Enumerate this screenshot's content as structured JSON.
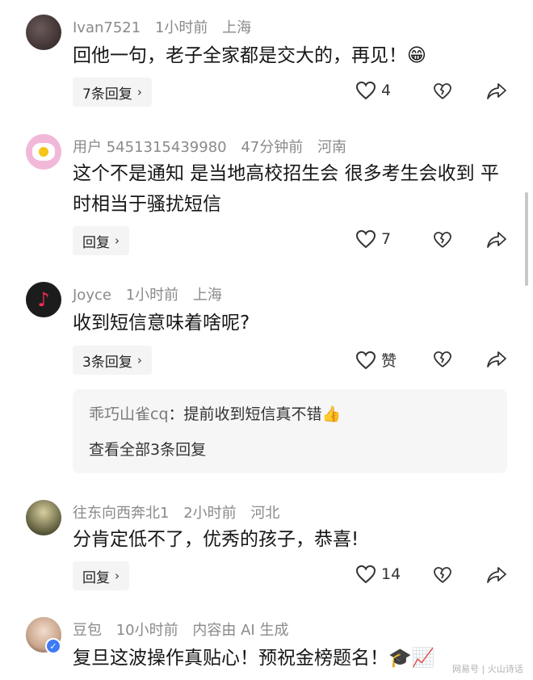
{
  "comments": [
    {
      "user": "Ivan7521",
      "time": "1小时前",
      "location": "上海",
      "text": "回他一句，老子全家都是交大的，再见！😁",
      "reply_label": "7条回复",
      "likes": "4"
    },
    {
      "user": "用户 5451315439980",
      "time": "47分钟前",
      "location": "河南",
      "text": "这个不是通知 是当地高校招生会 很多考生会收到 平时相当于骚扰短信",
      "reply_label": "回复",
      "likes": "7"
    },
    {
      "user": "Joyce",
      "time": "1小时前",
      "location": "上海",
      "text": "收到短信意味着啥呢?",
      "reply_label": "3条回复",
      "likes": "赞",
      "sub_reply": {
        "user": "乖巧山雀cq",
        "text": "提前收到短信真不错👍",
        "view_all": "查看全部3条回复"
      }
    },
    {
      "user": "往东向西奔北1",
      "time": "2小时前",
      "location": "河北",
      "text": "分肯定低不了，优秀的孩子，恭喜!",
      "reply_label": "回复",
      "likes": "14"
    },
    {
      "user": "豆包",
      "time": "10小时前",
      "location": "内容由 AI 生成",
      "text": "复旦这波操作真贴心！预祝金榜题名！🎓📈"
    }
  ],
  "icons": {
    "like": "heart-outline-icon",
    "dislike": "broken-heart-icon",
    "share": "share-arrow-icon",
    "chevron": "chevron-right-icon",
    "verified": "verified-check-icon"
  },
  "watermark": "网易号 | 火山诗话"
}
